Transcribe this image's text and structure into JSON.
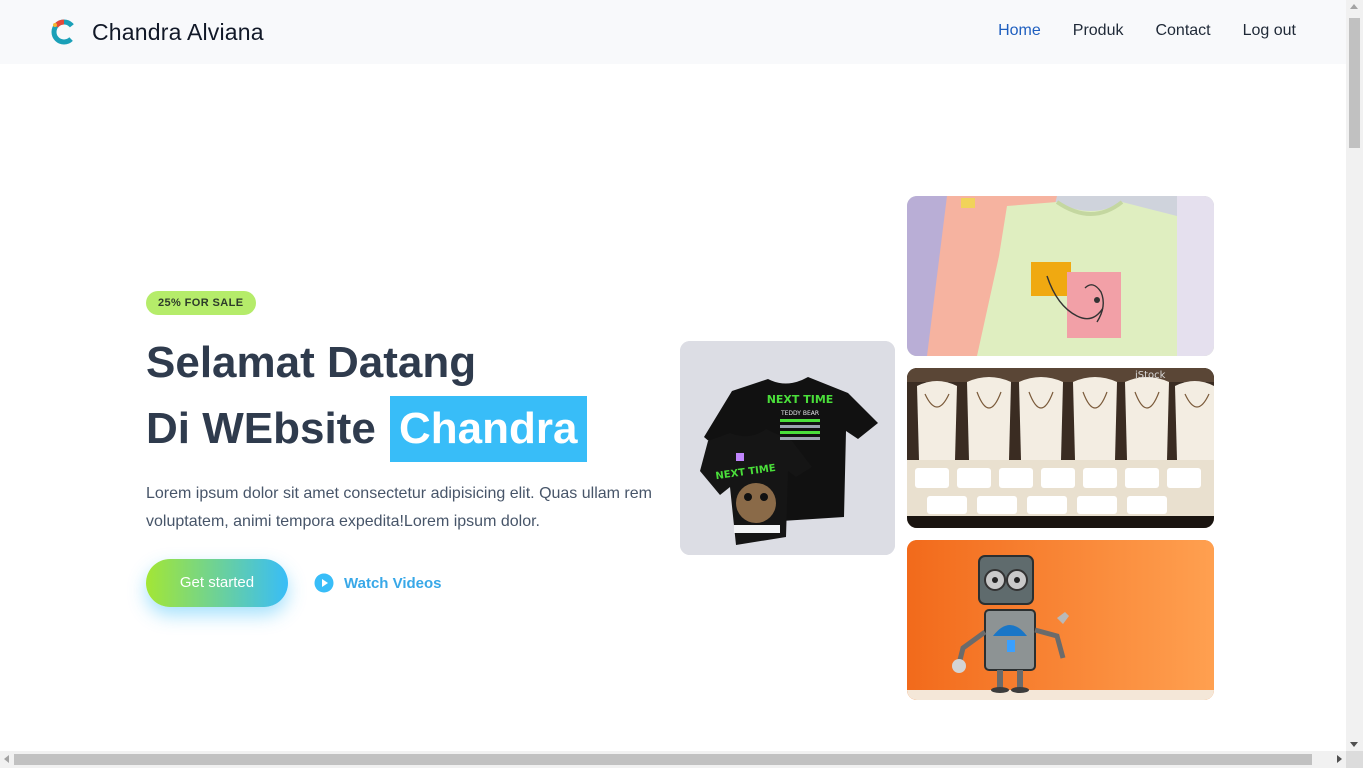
{
  "header": {
    "brand": "Chandra Alviana",
    "nav": [
      {
        "label": "Home",
        "active": true
      },
      {
        "label": "Produk",
        "active": false
      },
      {
        "label": "Contact",
        "active": false
      },
      {
        "label": "Log out",
        "active": false
      }
    ]
  },
  "hero": {
    "badge": "25% FOR SALE",
    "title_line1": "Selamat Datang",
    "title_line2": "Di WEbsite",
    "title_highlight": "Chandra",
    "description": "Lorem ipsum dolor sit amet consectetur adipisicing elit. Quas ullam rem voluptatem, animi tempora expedita!Lorem ipsum dolor.",
    "cta_label": "Get started",
    "watch_label": "Watch Videos"
  },
  "images": {
    "shirt_print_1": "NEXT TIME",
    "shirt_print_2": "TEDDY BEAR",
    "jewelry_watermark": "iStock"
  },
  "colors": {
    "accent": "#38bdf8",
    "badge": "#b5ec6a",
    "nav_active": "#1f5fbf",
    "title": "#2f3b4d"
  },
  "icons": {
    "logo": "brand-logo-c-icon",
    "watch": "play-circle-icon"
  }
}
